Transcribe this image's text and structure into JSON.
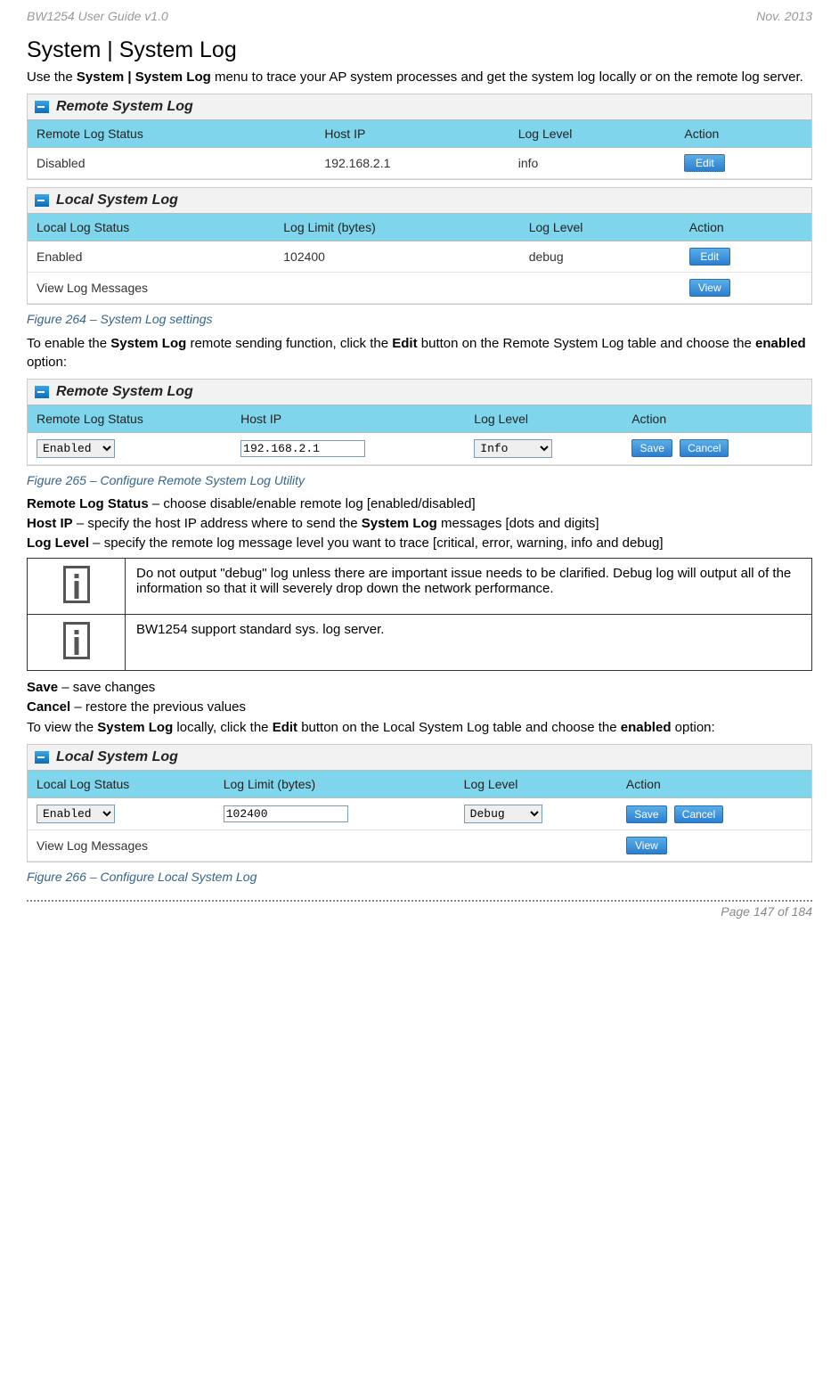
{
  "header": {
    "left": "BW1254 User Guide v1.0",
    "right": "Nov.  2013"
  },
  "section_heading": "System | System Log",
  "intro_para": {
    "pre": "Use the ",
    "bold": "System | System Log",
    "post": " menu to trace your AP system processes and get the system log locally or on the remote log server."
  },
  "panels": {
    "remote1": {
      "title": "Remote System Log",
      "headers": [
        "Remote Log Status",
        "Host IP",
        "Log Level",
        "Action"
      ],
      "row": {
        "status": "Disabled",
        "host": "192.168.2.1",
        "level": "info",
        "action": "Edit"
      }
    },
    "local1": {
      "title": "Local System Log",
      "headers": [
        "Local Log Status",
        "Log Limit (bytes)",
        "Log Level",
        "Action"
      ],
      "row": {
        "status": "Enabled",
        "limit": "102400",
        "level": "debug",
        "action": "Edit"
      },
      "viewrow": {
        "label": "View Log Messages",
        "action": "View"
      }
    },
    "remote2": {
      "title": "Remote System Log",
      "headers": [
        "Remote Log Status",
        "Host IP",
        "Log Level",
        "Action"
      ],
      "row": {
        "status": "Enabled",
        "host": "192.168.2.1",
        "level": "Info",
        "save": "Save",
        "cancel": "Cancel"
      }
    },
    "local2": {
      "title": "Local System Log",
      "headers": [
        "Local Log Status",
        "Log Limit (bytes)",
        "Log Level",
        "Action"
      ],
      "row": {
        "status": "Enabled",
        "limit": "102400",
        "level": "Debug",
        "save": "Save",
        "cancel": "Cancel"
      },
      "viewrow": {
        "label": "View Log Messages",
        "action": "View"
      }
    }
  },
  "captions": {
    "fig264": "Figure 264 – System Log settings",
    "fig265": "Figure 265 – Configure Remote System Log Utility",
    "fig266": "Figure 266 – Configure Local System Log"
  },
  "enable_para": {
    "pre": "To enable the ",
    "b1": "System Log",
    "mid1": " remote sending function, click the ",
    "b2": "Edit",
    "mid2": " button on the Remote System Log table and choose the ",
    "b3": "enabled",
    "post": " option:"
  },
  "terms": {
    "t1": {
      "b": "Remote Log Status",
      "rest": " – choose disable/enable remote log [enabled/disabled]"
    },
    "t2": {
      "b": "Host IP",
      "mid": " – specify the host IP address where to send the ",
      "b2": "System Log",
      "rest": " messages [dots and digits]"
    },
    "t3": {
      "b": "Log Level",
      "rest": " – specify the remote log message level you want to trace [critical, error, warning, info and debug]"
    }
  },
  "info_rows": {
    "r1": "Do not output \"debug\" log unless there are important issue needs to be clarified. Debug log will output all of the information so that it will severely drop down the network performance.",
    "r2": "BW1254 support standard sys. log server."
  },
  "save_line": {
    "b": "Save",
    "rest": " – save changes"
  },
  "cancel_line": {
    "b": "Cancel",
    "rest": " – restore the previous values"
  },
  "local_para": {
    "pre": "To view the ",
    "b1": "System Log",
    "mid1": " locally, click the ",
    "b2": "Edit",
    "mid2": " button on the Local System Log table and choose the ",
    "b3": "enabled",
    "post": " option:"
  },
  "footer": "Page 147 of 184"
}
